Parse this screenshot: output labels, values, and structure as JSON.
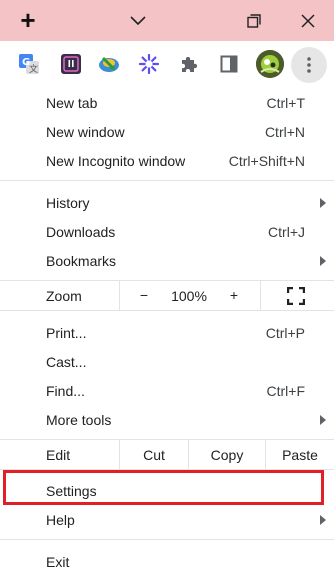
{
  "titlebar": {
    "new_tab_glyph": "+",
    "icons": [
      "chevron-down-icon",
      "restore-icon",
      "close-icon"
    ]
  },
  "toolbar": {
    "extensions": [
      "google-translate-icon",
      "dark-reader-icon",
      "jdownloader-icon",
      "star-extension-icon",
      "puzzle-icon",
      "side-panel-icon"
    ],
    "avatar": "profile-avatar",
    "menu_icon": "three-dot-menu-icon"
  },
  "menu": {
    "new_tab": {
      "label": "New tab",
      "shortcut": "Ctrl+T"
    },
    "new_window": {
      "label": "New window",
      "shortcut": "Ctrl+N"
    },
    "new_incognito": {
      "label": "New Incognito window",
      "shortcut": "Ctrl+Shift+N"
    },
    "history": {
      "label": "History"
    },
    "downloads": {
      "label": "Downloads",
      "shortcut": "Ctrl+J"
    },
    "bookmarks": {
      "label": "Bookmarks"
    },
    "zoom": {
      "label": "Zoom",
      "minus": "−",
      "value": "100%",
      "plus": "+"
    },
    "print": {
      "label": "Print...",
      "shortcut": "Ctrl+P"
    },
    "cast": {
      "label": "Cast..."
    },
    "find": {
      "label": "Find...",
      "shortcut": "Ctrl+F"
    },
    "more_tools": {
      "label": "More tools"
    },
    "edit": {
      "label": "Edit",
      "cut": "Cut",
      "copy": "Copy",
      "paste": "Paste"
    },
    "settings": {
      "label": "Settings"
    },
    "help": {
      "label": "Help"
    },
    "exit": {
      "label": "Exit"
    }
  },
  "colors": {
    "titlebar_bg": "#f4c3c6",
    "highlight": "#e01f26",
    "separator": "#e3e3e3"
  }
}
